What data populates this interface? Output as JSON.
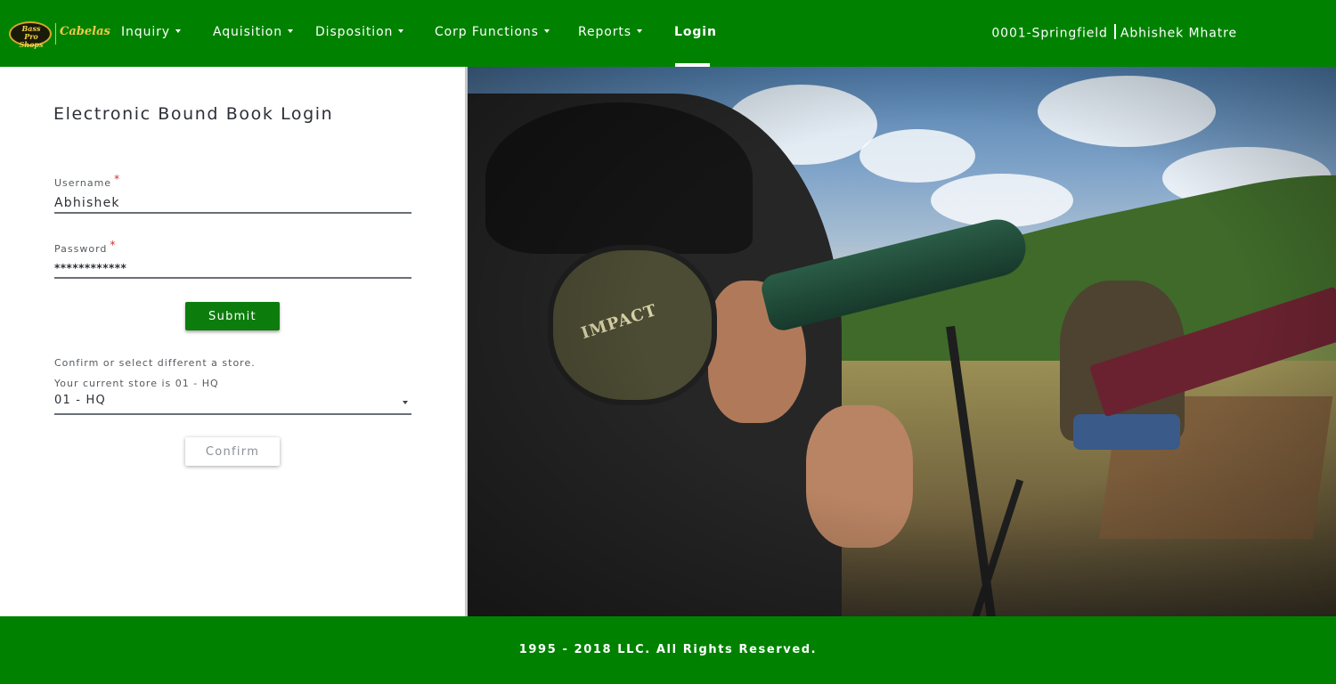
{
  "header": {
    "logo": {
      "badge_text": "Bass Pro Shops",
      "brand_text": "Cabelas"
    },
    "nav": [
      {
        "label": "Inquiry",
        "dropdown": true
      },
      {
        "label": "Aquisition",
        "dropdown": true
      },
      {
        "label": "Disposition",
        "dropdown": true
      },
      {
        "label": "Corp Functions",
        "dropdown": true
      },
      {
        "label": "Reports",
        "dropdown": true
      },
      {
        "label": "Login",
        "dropdown": false,
        "active": true
      }
    ],
    "store": "0001-Springfield",
    "user": "Abhishek Mhatre"
  },
  "login": {
    "title": "Electronic Bound Book Login",
    "username_label": "Username",
    "username_value": "Abhishek",
    "password_label": "Password",
    "password_value": "************",
    "required_mark": "*",
    "submit_label": "Submit",
    "confirm_prompt": "Confirm or select different a store.",
    "current_store_label": "Your current store is 01 - HQ",
    "store_selected": "01 - HQ",
    "confirm_label": "Confirm"
  },
  "footer": {
    "copyright": "1995 - 2018 LLC. All Rights Reserved."
  },
  "colors": {
    "brand_green": "#008200",
    "button_green": "#0c7d0c",
    "required_red": "#d32f2f"
  }
}
